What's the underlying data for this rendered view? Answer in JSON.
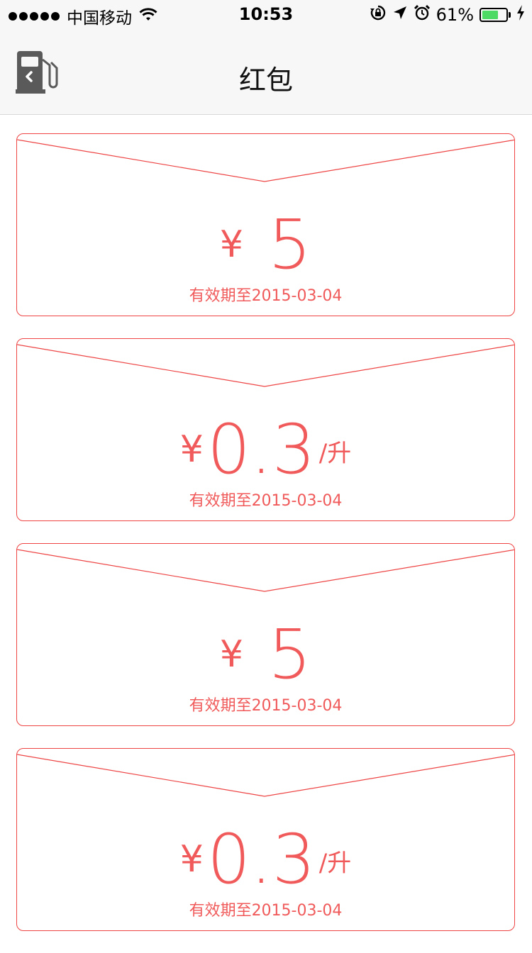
{
  "status_bar": {
    "carrier": "中国移动",
    "time": "10:53",
    "battery_percent": "61%",
    "battery_level": 0.61,
    "icons": [
      "signal-dots-icon",
      "wifi-icon",
      "rotation-lock-icon",
      "location-arrow-icon",
      "alarm-icon",
      "battery-icon",
      "charging-bolt-icon"
    ]
  },
  "nav": {
    "title": "红包",
    "back_icon": "fuel-pump-back-icon"
  },
  "colors": {
    "accent": "#f05a5a",
    "border": "#ee4444",
    "nav_bg": "#f7f7f7",
    "battery": "#4cd964"
  },
  "cards": [
    {
      "currency": "¥",
      "amount": "5",
      "unit": "",
      "expiry": "有效期至2015-03-04"
    },
    {
      "currency": "¥",
      "amount": "0.3",
      "unit": "/升",
      "expiry": "有效期至2015-03-04"
    },
    {
      "currency": "¥",
      "amount": "5",
      "unit": "",
      "expiry": "有效期至2015-03-04"
    },
    {
      "currency": "¥",
      "amount": "0.3",
      "unit": "/升",
      "expiry": "有效期至2015-03-04"
    }
  ]
}
